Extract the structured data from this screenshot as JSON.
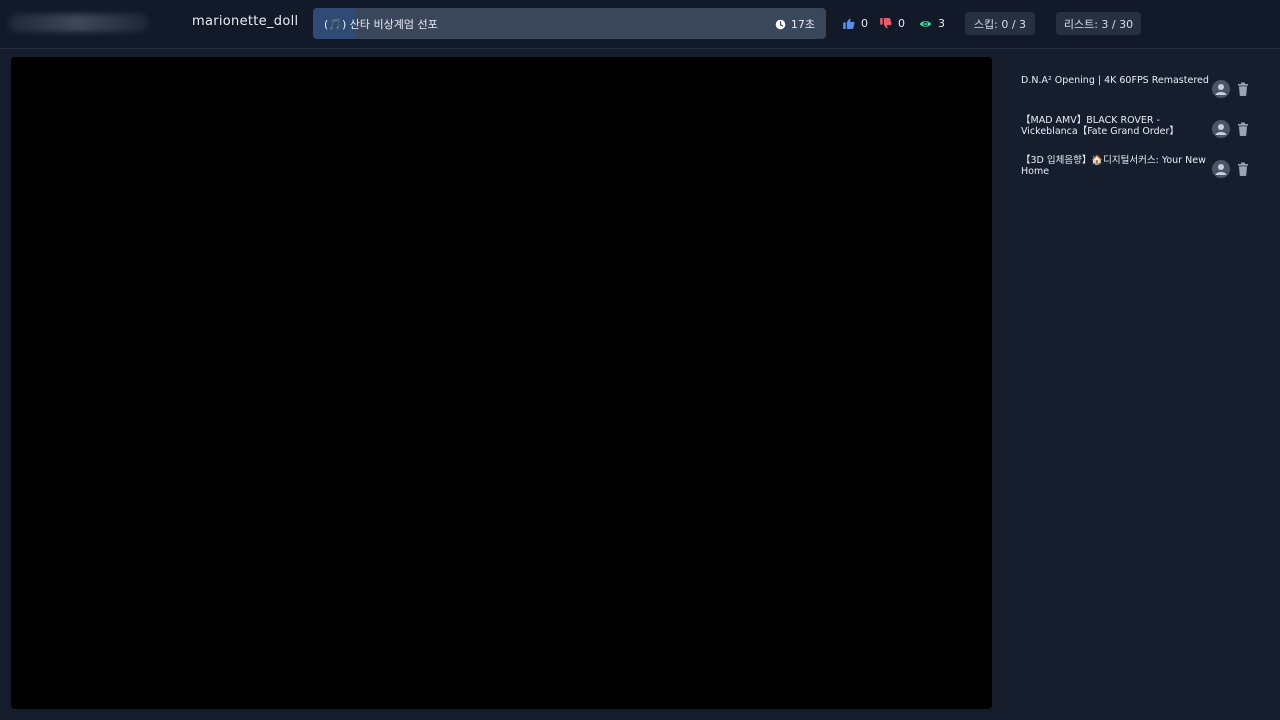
{
  "header": {
    "username": "marionette_doll",
    "now_playing": {
      "title": "(🎵) 산타 비상계엄 선포",
      "time_left": "17초",
      "progress_fraction": 0.083
    },
    "likes": "0",
    "dislikes": "0",
    "viewers": "3",
    "skip_label": "스킵: 0 / 3",
    "list_label": "리스트: 3 / 30"
  },
  "playlist": {
    "items": [
      {
        "title": "D.N.A² Opening | 4K 60FPS Remastered"
      },
      {
        "title": "【MAD AMV】BLACK ROVER - Vickeblanca【Fate Grand Order】"
      },
      {
        "title": "【3D 입체음향】🏠디지털서커스: Your New Home"
      }
    ]
  },
  "colors": {
    "like": "#5b8def",
    "dislike": "#e35d6a",
    "viewers": "#3ddc97"
  },
  "icons": [
    "clock-icon",
    "thumbs-up-icon",
    "thumbs-down-icon",
    "eye-icon",
    "user-icon",
    "trash-icon"
  ]
}
